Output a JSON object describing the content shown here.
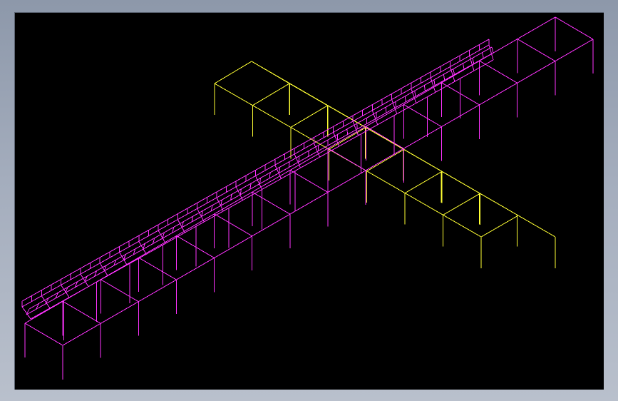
{
  "app": {
    "title": ""
  },
  "viewport": {
    "background": "#000000",
    "projection": "isometric"
  },
  "layers": [
    {
      "name": "",
      "color": "#ffff33"
    },
    {
      "name": "",
      "color": "#ff33ff"
    }
  ],
  "model": {
    "cross_frame": {
      "description": "",
      "bay_count": 7,
      "color": "#ffff33"
    },
    "long_frame": {
      "description": "",
      "bay_count": 14,
      "color": "#ff33ff",
      "has_walkway_railings": true
    }
  }
}
